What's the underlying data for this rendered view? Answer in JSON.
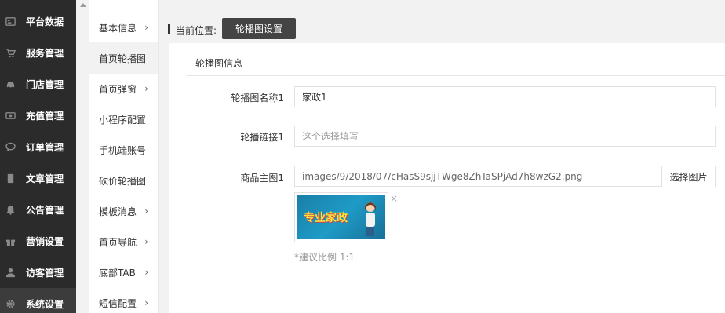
{
  "sidebar": {
    "items": [
      {
        "label": "平台数据",
        "icon": "dashboard-icon"
      },
      {
        "label": "服务管理",
        "icon": "cart-icon"
      },
      {
        "label": "门店管理",
        "icon": "car-icon"
      },
      {
        "label": "充值管理",
        "icon": "money-icon"
      },
      {
        "label": "订单管理",
        "icon": "chat-icon"
      },
      {
        "label": "文章管理",
        "icon": "book-icon"
      },
      {
        "label": "公告管理",
        "icon": "bell-icon"
      },
      {
        "label": "营销设置",
        "icon": "gift-icon"
      },
      {
        "label": "访客管理",
        "icon": "user-icon"
      },
      {
        "label": "系统设置",
        "icon": "gear-icon"
      }
    ]
  },
  "submenu": {
    "items": [
      {
        "label": "基本信息",
        "chevron": "›"
      },
      {
        "label": "首页轮播图",
        "chevron": ""
      },
      {
        "label": "首页弹窗",
        "chevron": "›"
      },
      {
        "label": "小程序配置",
        "chevron": ""
      },
      {
        "label": "手机端账号",
        "chevron": ""
      },
      {
        "label": "砍价轮播图",
        "chevron": ""
      },
      {
        "label": "模板消息",
        "chevron": "›"
      },
      {
        "label": "首页导航",
        "chevron": "›"
      },
      {
        "label": "底部TAB",
        "chevron": "›"
      },
      {
        "label": "短信配置",
        "chevron": "›"
      }
    ]
  },
  "breadcrumb": {
    "label": "当前位置:",
    "current": "轮播图设置"
  },
  "panel": {
    "title": "轮播图信息"
  },
  "form": {
    "name_label": "轮播图名称1",
    "name_value": "家政1",
    "link_label": "轮播链接1",
    "link_placeholder": "这个选择填写",
    "image_label": "商品主图1",
    "image_value": "images/9/2018/07/cHasS9sjjTWge8ZhTaSPjAd7h8wzG2.png",
    "pick_button": "选择图片",
    "thumb_text": "专业家政",
    "delete_icon": "×",
    "hint": "*建议比例 1:1"
  },
  "colors": {
    "sidebar_bg": "#2b2b2b",
    "button_bg": "#444444"
  }
}
